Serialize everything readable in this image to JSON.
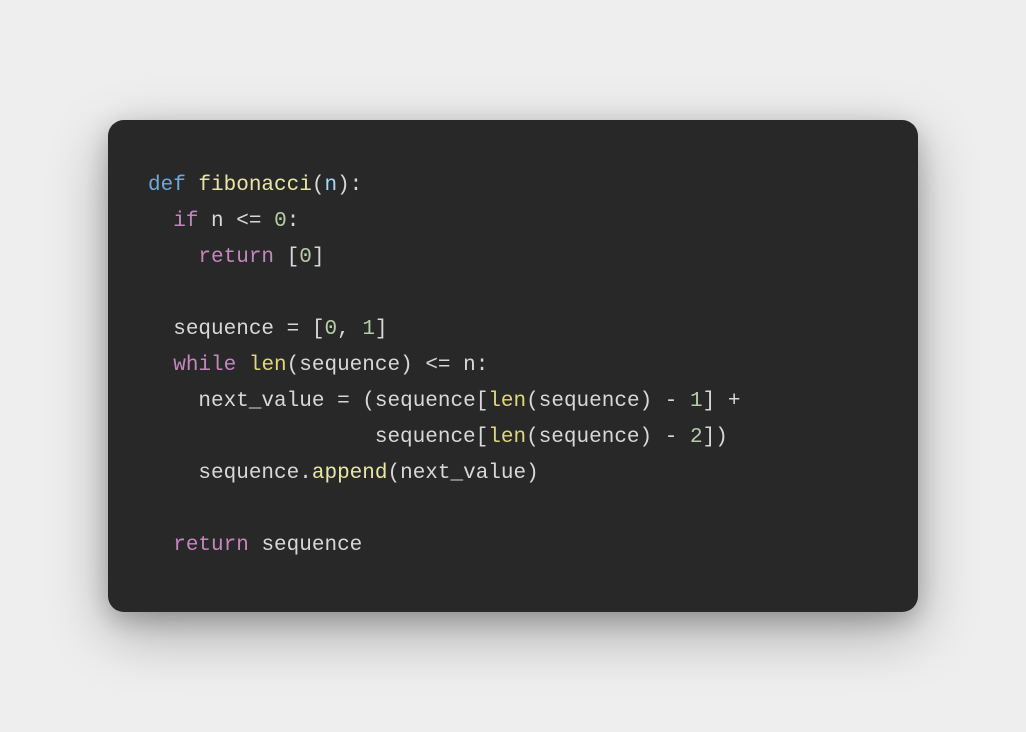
{
  "code": {
    "line1": {
      "def": "def",
      "sp1": " ",
      "fn": "fibonacci",
      "lp": "(",
      "param": "n",
      "rp": ")",
      "colon": ":"
    },
    "line2": {
      "indent": "  ",
      "if": "if",
      "sp1": " ",
      "var": "n",
      "sp2": " ",
      "op": "<=",
      "sp3": " ",
      "num": "0",
      "colon": ":"
    },
    "line3": {
      "indent": "    ",
      "return": "return",
      "sp1": " ",
      "lb": "[",
      "num": "0",
      "rb": "]"
    },
    "line4": {
      "blank": ""
    },
    "line5": {
      "indent": "  ",
      "var": "sequence",
      "sp1": " ",
      "eq": "=",
      "sp2": " ",
      "lb": "[",
      "n0": "0",
      "comma": ",",
      "sp3": " ",
      "n1": "1",
      "rb": "]"
    },
    "line6": {
      "indent": "  ",
      "while": "while",
      "sp1": " ",
      "len": "len",
      "lp": "(",
      "var": "sequence",
      "rp": ")",
      "sp2": " ",
      "op": "<=",
      "sp3": " ",
      "n": "n",
      "colon": ":"
    },
    "line7": {
      "indent": "    ",
      "var": "next_value",
      "sp1": " ",
      "eq": "=",
      "sp2": " ",
      "lp": "(",
      "seq": "sequence",
      "lb": "[",
      "len": "len",
      "lp2": "(",
      "seq2": "sequence",
      "rp2": ")",
      "sp3": " ",
      "minus": "-",
      "sp4": " ",
      "n1": "1",
      "rb": "]",
      "sp5": " ",
      "plus": "+"
    },
    "line8": {
      "indent": "                  ",
      "seq": "sequence",
      "lb": "[",
      "len": "len",
      "lp": "(",
      "seq2": "sequence",
      "rp": ")",
      "sp1": " ",
      "minus": "-",
      "sp2": " ",
      "n2": "2",
      "rb": "]",
      "rp2": ")"
    },
    "line9": {
      "indent": "    ",
      "seq": "sequence",
      "dot": ".",
      "append": "append",
      "lp": "(",
      "var": "next_value",
      "rp": ")"
    },
    "line10": {
      "blank": ""
    },
    "line11": {
      "indent": "  ",
      "return": "return",
      "sp1": " ",
      "var": "sequence"
    }
  }
}
